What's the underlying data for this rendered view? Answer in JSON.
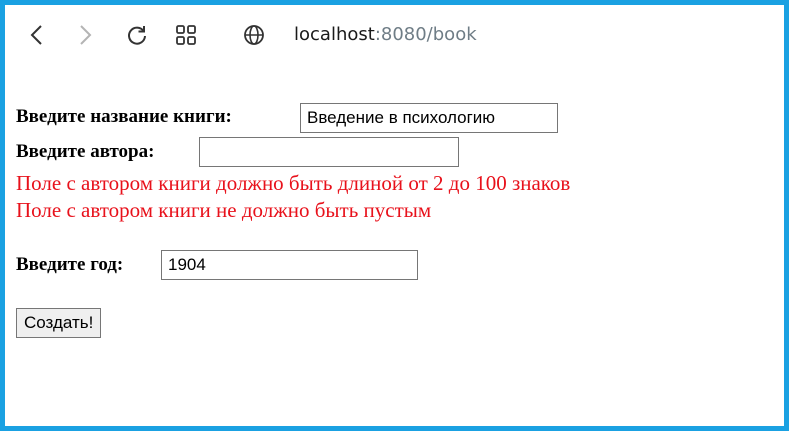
{
  "browser": {
    "url_host": "localhost",
    "url_path": ":8080/book",
    "icons": [
      "back-icon",
      "forward-icon",
      "reload-icon",
      "tabs-grid-icon",
      "globe-icon"
    ]
  },
  "form": {
    "title_label": "Введите название книги:",
    "title_value": "Введение в психологию",
    "author_label": "Введите автора:",
    "author_value": "",
    "author_errors": [
      "Поле с автором книги должно быть длиной от 2 до 100 знаков",
      "Поле с автором книги не должно быть пустым"
    ],
    "year_label": "Введите год:",
    "year_value": "1904",
    "submit_label": "Создать!"
  },
  "colors": {
    "frame": "#1aa1e2",
    "error": "#e8111b"
  }
}
